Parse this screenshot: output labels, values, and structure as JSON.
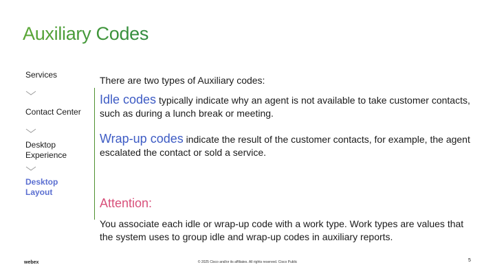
{
  "slide": {
    "title": "Auxiliary Codes",
    "page_number": "5",
    "copyright": "© 2025 Cisco and/or its affiliates. All rights reserved. Cisco Public",
    "logo_text": "webex"
  },
  "nav": {
    "items": [
      {
        "label": "Services",
        "active": false
      },
      {
        "label": "Contact Center",
        "active": false
      },
      {
        "label": "Desktop Experience",
        "active": false
      },
      {
        "label": "Desktop Layout",
        "active": true
      }
    ]
  },
  "content": {
    "intro": "There are two types of Auxiliary codes:",
    "idle_term": "Idle codes",
    "idle_text": " typically indicate why an agent is not available to take customer contacts, such as during a lunch break or meeting.",
    "wrapup_term": "Wrap-up codes",
    "wrapup_text": " indicate the result of the customer contacts, for example, the agent escalated the contact or sold a service.",
    "attention_label": "Attention:",
    "attention_text": "You associate each idle or wrap-up code with a work type. Work types are values that the system uses to group idle and wrap-up codes in auxiliary reports."
  },
  "colors": {
    "title_green": "#3f9a37",
    "nav_active": "#5b6fd1",
    "term_blue": "#3d5bc4",
    "attention_pink": "#d8507a",
    "divider_green": "#4d8f2e"
  }
}
